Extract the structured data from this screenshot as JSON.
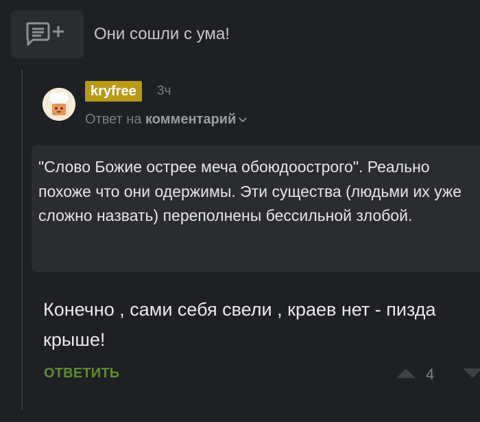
{
  "header": {
    "title": "Они сошли с ума!"
  },
  "comment": {
    "username": "kryfree",
    "time": "3ч",
    "reply_prefix": "Ответ на",
    "reply_target": "комментарий",
    "quote": "\"Слово Божие острее меча обоюдоострого\". Реально похоже что они одержимы. Эти существа (людьми их уже сложно назвать) переполнены бессильной злобой.",
    "body": "Конечно , сами себя свели , краев нет - пизда крыше!",
    "reply_label": "ОТВЕТИТЬ",
    "rating": "4"
  },
  "colors": {
    "background": "#1e2023",
    "username_badge": "#b99a17",
    "reply_button": "#5f8c2e",
    "quote_background": "#2a2c30"
  }
}
